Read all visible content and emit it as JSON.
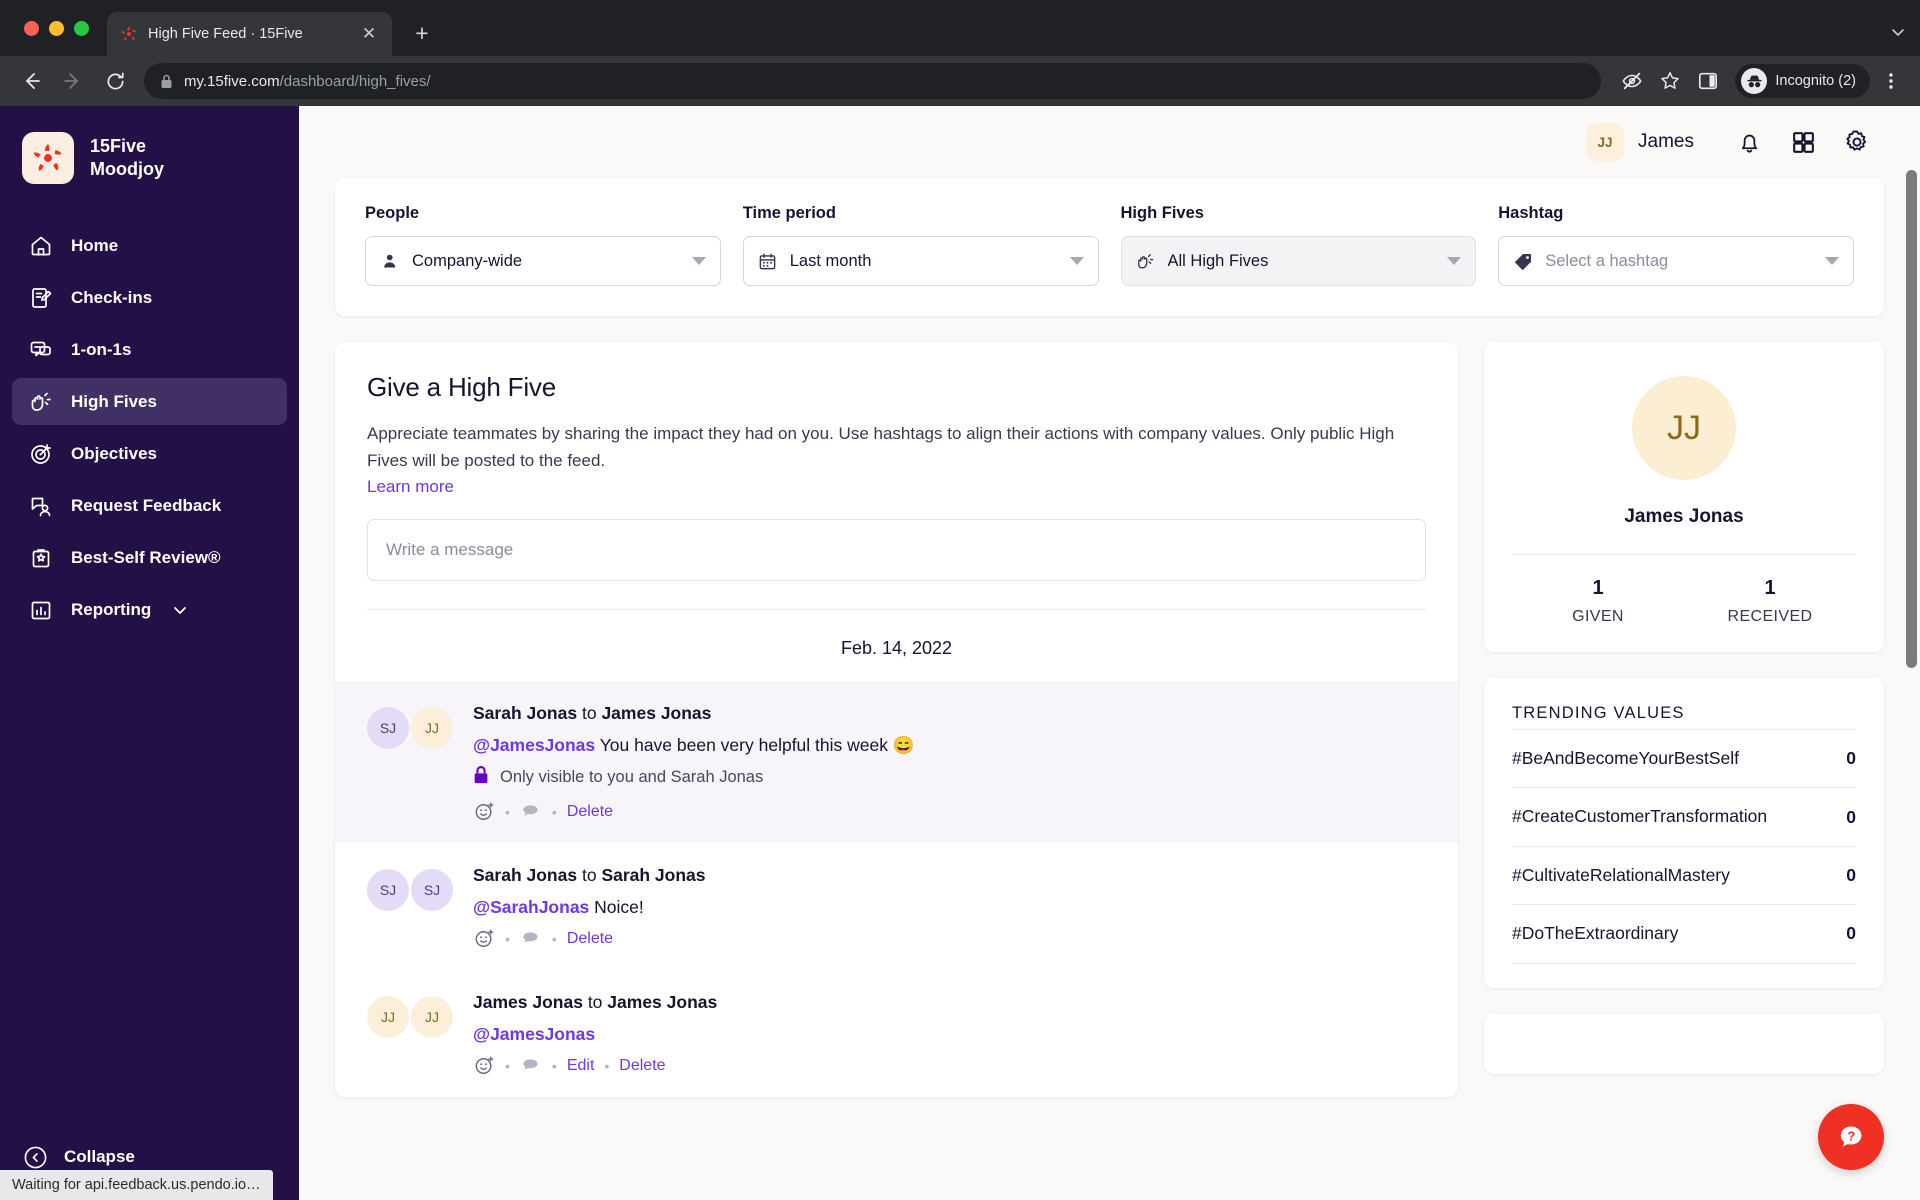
{
  "browser": {
    "tab_title": "High Five Feed · 15Five",
    "tab_close_label": "✕",
    "new_tab_label": "+",
    "url_domain": "my.15five.com",
    "url_path": "/dashboard/high_fives/",
    "profile_label": "Incognito (2)",
    "status_text": "Waiting for api.feedback.us.pendo.io…"
  },
  "sidebar": {
    "brand_line1": "15Five",
    "brand_line2": "Moodjoy",
    "items": [
      {
        "label": "Home",
        "icon": "home-icon",
        "active": false
      },
      {
        "label": "Check-ins",
        "icon": "checkins-icon",
        "active": false
      },
      {
        "label": "1-on-1s",
        "icon": "chat-icon",
        "active": false
      },
      {
        "label": "High Fives",
        "icon": "highfive-icon",
        "active": true
      },
      {
        "label": "Objectives",
        "icon": "target-icon",
        "active": false
      },
      {
        "label": "Request Feedback",
        "icon": "feedback-icon",
        "active": false
      },
      {
        "label": "Best-Self Review®",
        "icon": "review-icon",
        "active": false
      },
      {
        "label": "Reporting",
        "icon": "bars-icon",
        "active": false,
        "chevron": true
      }
    ],
    "collapse_label": "Collapse"
  },
  "topbar": {
    "avatar_initials": "JJ",
    "user_name": "James",
    "icons": [
      "bell-icon",
      "apps-grid-icon",
      "gear-icon"
    ]
  },
  "filters": [
    {
      "label": "People",
      "icon": "person-icon",
      "value": "Company-wide",
      "placeholder": false,
      "muted": false
    },
    {
      "label": "Time period",
      "icon": "calendar-icon",
      "value": "Last month",
      "placeholder": false,
      "muted": false
    },
    {
      "label": "High Fives",
      "icon": "highfive-icon",
      "value": "All High Fives",
      "placeholder": false,
      "muted": true
    },
    {
      "label": "Hashtag",
      "icon": "tag-icon",
      "value": "Select a hashtag",
      "placeholder": true,
      "muted": false
    }
  ],
  "give": {
    "title": "Give a High Five",
    "description": "Appreciate teammates by sharing the impact they had on you. Use hashtags to align their actions with company values. Only public High Fives will be posted to the feed.",
    "learn_more": "Learn more",
    "message_placeholder": "Write a message"
  },
  "feed": {
    "date_header": "Feb. 14, 2022",
    "posts": [
      {
        "highlighted": true,
        "avatars": [
          {
            "initials": "SJ",
            "tone": "purple"
          },
          {
            "initials": "JJ",
            "tone": "peach"
          }
        ],
        "from": "Sarah Jonas",
        "to_word": "to",
        "to": "James Jonas",
        "mention": "@JamesJonas",
        "message": "You have been very helpful this week 😄",
        "visibility": "Only visible to you and Sarah Jonas",
        "actions": [
          "Delete"
        ]
      },
      {
        "highlighted": false,
        "avatars": [
          {
            "initials": "SJ",
            "tone": "purple"
          },
          {
            "initials": "SJ",
            "tone": "purple"
          }
        ],
        "from": "Sarah Jonas",
        "to_word": "to",
        "to": "Sarah Jonas",
        "mention": "@SarahJonas",
        "message": "Noice!",
        "visibility": "",
        "actions": [
          "Delete"
        ]
      },
      {
        "highlighted": false,
        "avatars": [
          {
            "initials": "JJ",
            "tone": "peach"
          },
          {
            "initials": "JJ",
            "tone": "peach"
          }
        ],
        "from": "James Jonas",
        "to_word": "to",
        "to": "James Jonas",
        "mention": "@JamesJonas",
        "message": "",
        "visibility": "",
        "actions": [
          "Edit",
          "Delete"
        ]
      }
    ]
  },
  "profile": {
    "avatar_initials": "JJ",
    "name": "James Jonas",
    "given_value": "1",
    "given_label": "GIVEN",
    "received_value": "1",
    "received_label": "RECEIVED"
  },
  "trending": {
    "title": "TRENDING VALUES",
    "rows": [
      {
        "name": "#BeAndBecomeYourBestSelf",
        "value": "0"
      },
      {
        "name": "#CreateCustomerTransformation",
        "value": "0"
      },
      {
        "name": "#CultivateRelationalMastery",
        "value": "0"
      },
      {
        "name": "#DoTheExtraordinary",
        "value": "0"
      }
    ]
  },
  "help": {
    "icon": "help-question-icon"
  },
  "colors": {
    "sidebar_bg": "#221046",
    "sidebar_active": "#413063",
    "accent_purple": "#6f38e0",
    "brand_red": "#ef3124",
    "page_bg": "#fbf9f8",
    "avatar_purple": "#e4dcf7",
    "avatar_peach": "#fcefd9"
  }
}
